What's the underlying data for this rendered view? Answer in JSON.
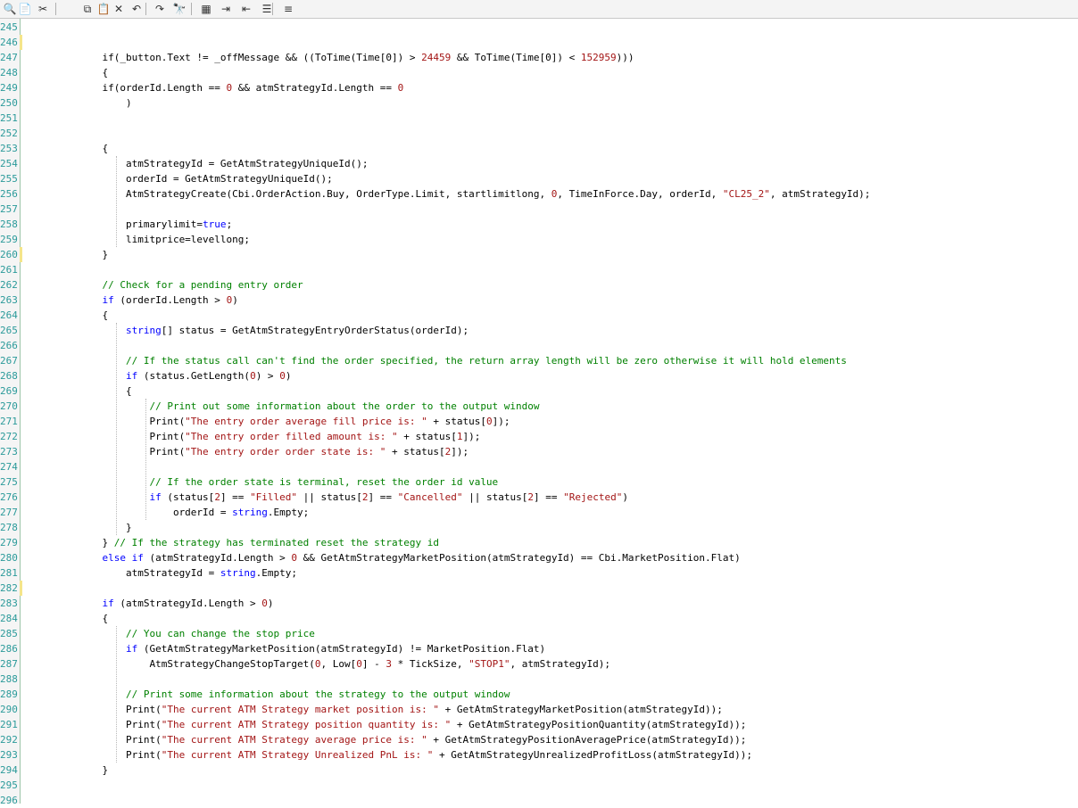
{
  "toolbar": {
    "buttons": [
      {
        "name": "print-preview-icon",
        "glyph": "🔍"
      },
      {
        "name": "page-setup-icon",
        "glyph": "📄"
      },
      {
        "name": "cut-icon",
        "glyph": "✂"
      },
      {
        "name": "copy-icon",
        "glyph": "⧉"
      },
      {
        "name": "paste-icon",
        "glyph": "📋"
      },
      {
        "name": "delete-icon",
        "glyph": "✕"
      },
      {
        "name": "undo-icon",
        "glyph": "↶"
      },
      {
        "name": "redo-icon",
        "glyph": "↷"
      },
      {
        "name": "find-icon",
        "glyph": "🔭"
      },
      {
        "name": "replace-icon",
        "glyph": "▦"
      },
      {
        "name": "indent-icon",
        "glyph": "⇥"
      },
      {
        "name": "outdent-icon",
        "glyph": "⇤"
      },
      {
        "name": "comment-icon",
        "glyph": "☰"
      },
      {
        "name": "uncomment-icon",
        "glyph": "≡"
      }
    ]
  },
  "editor": {
    "lines": [
      {
        "n": "245",
        "t": []
      },
      {
        "n": "246",
        "t": []
      },
      {
        "n": "247",
        "t": [
          [
            "",
            "            if(_button.Text != _offMessage && ((ToTime(Time[0]) > "
          ],
          [
            "nm",
            "24459"
          ],
          [
            "",
            " && ToTime(Time[0]) < "
          ],
          [
            "nm",
            "152959"
          ],
          [
            "",
            ")))"
          ]
        ]
      },
      {
        "n": "248",
        "t": [
          [
            "",
            "            {"
          ]
        ]
      },
      {
        "n": "249",
        "t": [
          [
            "",
            "            if(orderId.Length == "
          ],
          [
            "nm",
            "0"
          ],
          [
            "",
            " && atmStrategyId.Length == "
          ],
          [
            "nm",
            "0"
          ]
        ]
      },
      {
        "n": "250",
        "t": [
          [
            "",
            "                )"
          ]
        ]
      },
      {
        "n": "251",
        "t": []
      },
      {
        "n": "252",
        "t": []
      },
      {
        "n": "253",
        "t": [
          [
            "",
            "            {"
          ]
        ]
      },
      {
        "n": "254",
        "t": [
          [
            "",
            "                atmStrategyId = GetAtmStrategyUniqueId();"
          ]
        ]
      },
      {
        "n": "255",
        "t": [
          [
            "",
            "                orderId = GetAtmStrategyUniqueId();"
          ]
        ]
      },
      {
        "n": "256",
        "t": [
          [
            "",
            "                AtmStrategyCreate(Cbi.OrderAction.Buy, OrderType.Limit, startlimitlong, "
          ],
          [
            "nm",
            "0"
          ],
          [
            "",
            ", TimeInForce.Day, orderId, "
          ],
          [
            "st",
            "\"CL25_2\""
          ],
          [
            "",
            ", atmStrategyId);"
          ]
        ]
      },
      {
        "n": "257",
        "t": []
      },
      {
        "n": "258",
        "t": [
          [
            "",
            "                primarylimit="
          ],
          [
            "kw",
            "true"
          ],
          [
            "",
            ";"
          ]
        ]
      },
      {
        "n": "259",
        "t": [
          [
            "",
            "                limitprice=levellong;"
          ]
        ]
      },
      {
        "n": "260",
        "t": [
          [
            "",
            "            }"
          ]
        ]
      },
      {
        "n": "261",
        "t": []
      },
      {
        "n": "262",
        "t": [
          [
            "cm",
            "            // Check for a pending entry order"
          ]
        ]
      },
      {
        "n": "263",
        "t": [
          [
            "kw",
            "            if"
          ],
          [
            "",
            " (orderId.Length > "
          ],
          [
            "nm",
            "0"
          ],
          [
            "",
            ")"
          ]
        ]
      },
      {
        "n": "264",
        "t": [
          [
            "",
            "            {"
          ]
        ]
      },
      {
        "n": "265",
        "t": [
          [
            "kw",
            "                string"
          ],
          [
            "",
            "[] status = GetAtmStrategyEntryOrderStatus(orderId);"
          ]
        ]
      },
      {
        "n": "266",
        "t": []
      },
      {
        "n": "267",
        "t": [
          [
            "cm",
            "                // If the status call can't find the order specified, the return array length will be zero otherwise it will hold elements"
          ]
        ]
      },
      {
        "n": "268",
        "t": [
          [
            "kw",
            "                if"
          ],
          [
            "",
            " (status.GetLength("
          ],
          [
            "nm",
            "0"
          ],
          [
            "",
            ") > "
          ],
          [
            "nm",
            "0"
          ],
          [
            "",
            ")"
          ]
        ]
      },
      {
        "n": "269",
        "t": [
          [
            "",
            "                {"
          ]
        ]
      },
      {
        "n": "270",
        "t": [
          [
            "cm",
            "                    // Print out some information about the order to the output window"
          ]
        ]
      },
      {
        "n": "271",
        "t": [
          [
            "",
            "                    Print("
          ],
          [
            "st",
            "\"The entry order average fill price is: \""
          ],
          [
            "",
            " + status["
          ],
          [
            "nm",
            "0"
          ],
          [
            "",
            "]);"
          ]
        ]
      },
      {
        "n": "272",
        "t": [
          [
            "",
            "                    Print("
          ],
          [
            "st",
            "\"The entry order filled amount is: \""
          ],
          [
            "",
            " + status["
          ],
          [
            "nm",
            "1"
          ],
          [
            "",
            "]);"
          ]
        ]
      },
      {
        "n": "273",
        "t": [
          [
            "",
            "                    Print("
          ],
          [
            "st",
            "\"The entry order order state is: \""
          ],
          [
            "",
            " + status["
          ],
          [
            "nm",
            "2"
          ],
          [
            "",
            "]);"
          ]
        ]
      },
      {
        "n": "274",
        "t": []
      },
      {
        "n": "275",
        "t": [
          [
            "cm",
            "                    // If the order state is terminal, reset the order id value"
          ]
        ]
      },
      {
        "n": "276",
        "t": [
          [
            "kw",
            "                    if"
          ],
          [
            "",
            " (status["
          ],
          [
            "nm",
            "2"
          ],
          [
            "",
            "] == "
          ],
          [
            "st",
            "\"Filled\""
          ],
          [
            "",
            " || status["
          ],
          [
            "nm",
            "2"
          ],
          [
            "",
            "] == "
          ],
          [
            "st",
            "\"Cancelled\""
          ],
          [
            "",
            " || status["
          ],
          [
            "nm",
            "2"
          ],
          [
            "",
            "] == "
          ],
          [
            "st",
            "\"Rejected\""
          ],
          [
            "",
            ")"
          ]
        ]
      },
      {
        "n": "277",
        "t": [
          [
            "",
            "                        orderId = "
          ],
          [
            "kw",
            "string"
          ],
          [
            "",
            ".Empty;"
          ]
        ]
      },
      {
        "n": "278",
        "t": [
          [
            "",
            "                }"
          ]
        ]
      },
      {
        "n": "279",
        "t": [
          [
            "",
            "            } "
          ],
          [
            "cm",
            "// If the strategy has terminated reset the strategy id"
          ]
        ]
      },
      {
        "n": "280",
        "t": [
          [
            "kw",
            "            else if"
          ],
          [
            "",
            " (atmStrategyId.Length > "
          ],
          [
            "nm",
            "0"
          ],
          [
            "",
            " && GetAtmStrategyMarketPosition(atmStrategyId) == Cbi.MarketPosition.Flat)"
          ]
        ]
      },
      {
        "n": "281",
        "t": [
          [
            "",
            "                atmStrategyId = "
          ],
          [
            "kw",
            "string"
          ],
          [
            "",
            ".Empty;"
          ]
        ]
      },
      {
        "n": "282",
        "t": []
      },
      {
        "n": "283",
        "t": [
          [
            "kw",
            "            if"
          ],
          [
            "",
            " (atmStrategyId.Length > "
          ],
          [
            "nm",
            "0"
          ],
          [
            "",
            ")"
          ]
        ]
      },
      {
        "n": "284",
        "t": [
          [
            "",
            "            {"
          ]
        ]
      },
      {
        "n": "285",
        "t": [
          [
            "cm",
            "                // You can change the stop price"
          ]
        ]
      },
      {
        "n": "286",
        "t": [
          [
            "kw",
            "                if"
          ],
          [
            "",
            " (GetAtmStrategyMarketPosition(atmStrategyId) != MarketPosition.Flat)"
          ]
        ]
      },
      {
        "n": "287",
        "t": [
          [
            "",
            "                    AtmStrategyChangeStopTarget("
          ],
          [
            "nm",
            "0"
          ],
          [
            "",
            ", Low["
          ],
          [
            "nm",
            "0"
          ],
          [
            "",
            "] - "
          ],
          [
            "nm",
            "3"
          ],
          [
            "",
            " * TickSize, "
          ],
          [
            "st",
            "\"STOP1\""
          ],
          [
            "",
            ", atmStrategyId);"
          ]
        ]
      },
      {
        "n": "288",
        "t": []
      },
      {
        "n": "289",
        "t": [
          [
            "cm",
            "                // Print some information about the strategy to the output window"
          ]
        ]
      },
      {
        "n": "290",
        "t": [
          [
            "",
            "                Print("
          ],
          [
            "st",
            "\"The current ATM Strategy market position is: \""
          ],
          [
            "",
            " + GetAtmStrategyMarketPosition(atmStrategyId));"
          ]
        ]
      },
      {
        "n": "291",
        "t": [
          [
            "",
            "                Print("
          ],
          [
            "st",
            "\"The current ATM Strategy position quantity is: \""
          ],
          [
            "",
            " + GetAtmStrategyPositionQuantity(atmStrategyId));"
          ]
        ]
      },
      {
        "n": "292",
        "t": [
          [
            "",
            "                Print("
          ],
          [
            "st",
            "\"The current ATM Strategy average price is: \""
          ],
          [
            "",
            " + GetAtmStrategyPositionAveragePrice(atmStrategyId));"
          ]
        ]
      },
      {
        "n": "293",
        "t": [
          [
            "",
            "                Print("
          ],
          [
            "st",
            "\"The current ATM Strategy Unrealized PnL is: \""
          ],
          [
            "",
            " + GetAtmStrategyUnrealizedProfitLoss(atmStrategyId));"
          ]
        ]
      },
      {
        "n": "294",
        "t": [
          [
            "",
            "            }"
          ]
        ]
      },
      {
        "n": "295",
        "t": []
      },
      {
        "n": "296",
        "t": []
      }
    ],
    "changed_lines": [
      "246",
      "260",
      "282"
    ]
  }
}
